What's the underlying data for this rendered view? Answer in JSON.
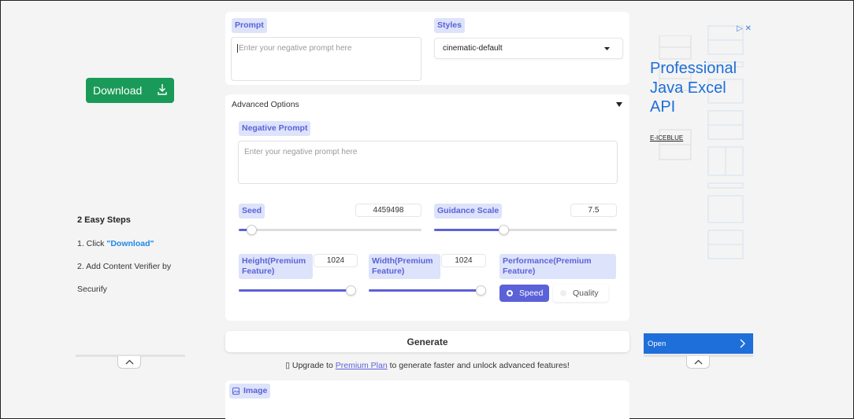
{
  "left_ad": {
    "download_label": "Download",
    "steps_title": "2 Easy Steps",
    "step1_prefix": "1. Click ",
    "step1_link": "\"Download\"",
    "step2": "2. Add Content Verifier by",
    "step2_cont": "Securify"
  },
  "prompt_card": {
    "prompt_label": "Prompt",
    "prompt_placeholder": "Enter your negative prompt here",
    "styles_label": "Styles",
    "styles_value": "cinematic-default"
  },
  "advanced": {
    "title": "Advanced Options",
    "neg_label": "Negative Prompt",
    "neg_placeholder": "Enter your negative prompt here",
    "seed_label": "Seed",
    "seed_value": "4459498",
    "seed_fraction": 0.07,
    "guidance_label": "Guidance Scale",
    "guidance_value": "7.5",
    "guidance_fraction": 0.38,
    "height_label": "Height(Premium Feature)",
    "height_value": "1024",
    "height_fraction": 0.97,
    "width_label": "Width(Premium Feature)",
    "width_value": "1024",
    "width_fraction": 0.97,
    "performance_label": "Performance(Premium Feature)",
    "speed_label": "Speed",
    "quality_label": "Quality"
  },
  "generate_label": "Generate",
  "upgrade": {
    "icon": "▯",
    "prefix": " Upgrade to ",
    "link": "Premium Plan",
    "suffix": " to generate faster and unlock advanced features!"
  },
  "image_label": "Image",
  "right_ad": {
    "title": "Professional Java Excel API",
    "brand": "E-ICEBLUE",
    "open_label": "Open"
  },
  "colors": {
    "accent": "#5b62d8",
    "download_green": "#1a9a58",
    "ad_blue": "#1e6fd9"
  }
}
